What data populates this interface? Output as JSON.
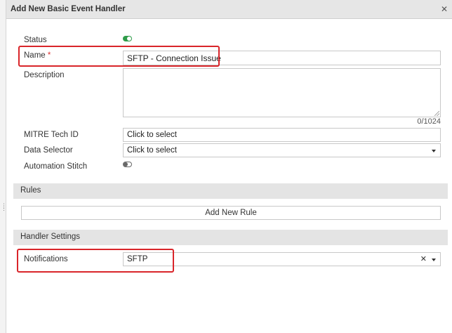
{
  "dialog": {
    "title": "Add New Basic Event Handler",
    "close_icon": "close-icon"
  },
  "form": {
    "status_label": "Status",
    "status_enabled": true,
    "name_label": "Name",
    "name_required_mark": "*",
    "name_value": "SFTP - Connection Issue",
    "description_label": "Description",
    "description_value": "",
    "description_counter": "0/1024",
    "mitre_label": "MITRE Tech ID",
    "mitre_placeholder": "Click to select",
    "data_selector_label": "Data Selector",
    "data_selector_placeholder": "Click to select",
    "automation_stitch_label": "Automation Stitch",
    "automation_stitch_enabled": false
  },
  "rules": {
    "section_title": "Rules",
    "add_rule_label": "Add New Rule"
  },
  "handler_settings": {
    "section_title": "Handler Settings",
    "notifications_label": "Notifications",
    "notifications_value": "SFTP"
  },
  "colors": {
    "toggle_on": "#2f9c4a",
    "highlight": "#d9252a",
    "section_bg": "#e4e4e4"
  }
}
